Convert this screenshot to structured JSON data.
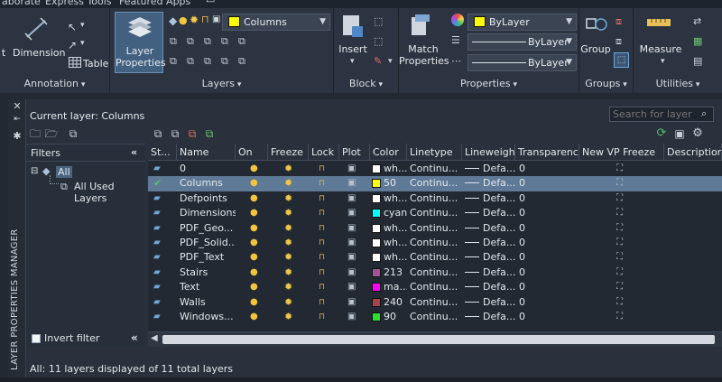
{
  "ribbon": {
    "menu": [
      "aborate",
      "Express Tools",
      "Featured Apps"
    ],
    "annotation": {
      "title": "Annotation",
      "dimension_label": "Dimension",
      "table_label": "Table",
      "text_label": "t"
    },
    "layers": {
      "title": "Layers",
      "properties_label": "Layer\nProperties",
      "combo_value": "Columns",
      "combo_swatch": "#ffff00"
    },
    "block": {
      "title": "Block",
      "insert_label": "Insert"
    },
    "properties": {
      "title": "Properties",
      "match_label": "Match\nProperties",
      "color_value": "ByLayer",
      "color_swatch": "#ffff00",
      "linetype_value": "ByLayer",
      "lineweight_value": "ByLayer"
    },
    "groups": {
      "title": "Groups",
      "group_label": "Group"
    },
    "utilities": {
      "title": "Utilities",
      "measure_label": "Measure"
    }
  },
  "palette": {
    "side_title": "LAYER PROPERTIES MANAGER",
    "current_layer": "Current layer: Columns",
    "search_placeholder": "Search for layer",
    "filters": {
      "header": "Filters",
      "tree_all": "All",
      "tree_used": "All Used Layers",
      "invert_label": "Invert filter"
    },
    "columns": [
      "St...",
      "Name",
      "On",
      "Freeze",
      "Lock",
      "Plot",
      "Color",
      "Linetype",
      "Lineweight",
      "Transparency",
      "New VP Freeze",
      "Description"
    ],
    "layers": [
      {
        "name": "0",
        "color_name": "wh...",
        "color": "#ffffff",
        "linetype": "Continu...",
        "lineweight": "Defa...",
        "transparency": "0",
        "current": false
      },
      {
        "name": "Columns",
        "color_name": "50",
        "color": "#ffff00",
        "linetype": "Continu...",
        "lineweight": "Defa...",
        "transparency": "0",
        "current": true
      },
      {
        "name": "Defpoints",
        "color_name": "wh...",
        "color": "#ffffff",
        "linetype": "Continu...",
        "lineweight": "Defa...",
        "transparency": "0",
        "current": false
      },
      {
        "name": "Dimensions",
        "color_name": "cyan",
        "color": "#00ffff",
        "linetype": "Continu...",
        "lineweight": "Defa...",
        "transparency": "0",
        "current": false
      },
      {
        "name": "PDF_Geo...",
        "color_name": "wh...",
        "color": "#ffffff",
        "linetype": "Continu...",
        "lineweight": "Defa...",
        "transparency": "0",
        "current": false
      },
      {
        "name": "PDF_Solid...",
        "color_name": "wh...",
        "color": "#ffffff",
        "linetype": "Continu...",
        "lineweight": "Defa...",
        "transparency": "0",
        "current": false
      },
      {
        "name": "PDF_Text",
        "color_name": "wh...",
        "color": "#ffffff",
        "linetype": "Continu...",
        "lineweight": "Defa...",
        "transparency": "0",
        "current": false
      },
      {
        "name": "Stairs",
        "color_name": "213",
        "color": "#a0559a",
        "linetype": "Continu...",
        "lineweight": "Defa...",
        "transparency": "0",
        "current": false
      },
      {
        "name": "Text",
        "color_name": "ma...",
        "color": "#ff00ff",
        "linetype": "Continu...",
        "lineweight": "Defa...",
        "transparency": "0",
        "current": false
      },
      {
        "name": "Walls",
        "color_name": "240",
        "color": "#a8424b",
        "linetype": "Continu...",
        "lineweight": "Defa...",
        "transparency": "0",
        "current": false
      },
      {
        "name": "Windows...",
        "color_name": "90",
        "color": "#2ee02e",
        "linetype": "Continu...",
        "lineweight": "Defa...",
        "transparency": "0",
        "current": false
      }
    ],
    "status": "All: 11 layers displayed of 11 total layers",
    "selected_index": 1
  },
  "colors": {
    "selection": "#5e7a96",
    "accent": "#4a6582"
  }
}
